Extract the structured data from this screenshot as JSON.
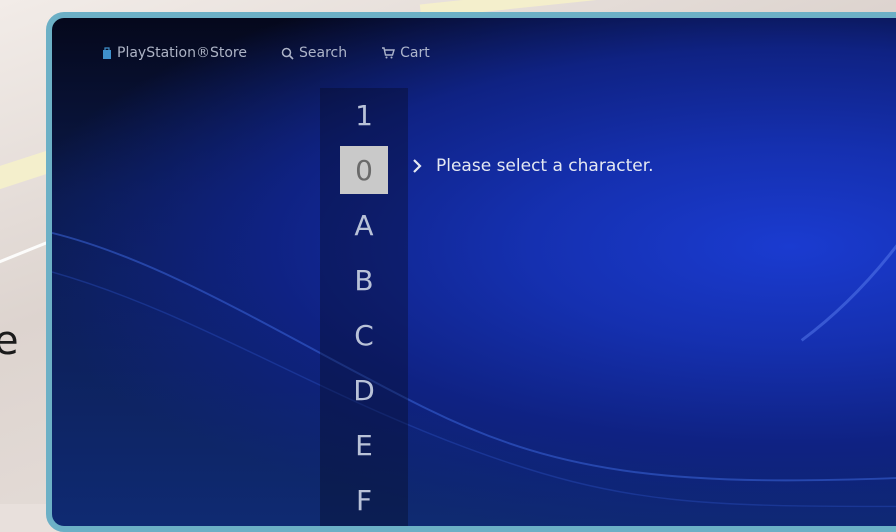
{
  "topbar": {
    "store_label": "PlayStation®Store",
    "search_label": "Search",
    "cart_label": "Cart"
  },
  "character_list": {
    "items": [
      "1",
      "0",
      "A",
      "B",
      "C",
      "D",
      "E",
      "F"
    ],
    "selected": "0"
  },
  "prompt": {
    "text": "Please select a character."
  },
  "backdrop": {
    "partial_letter": "e"
  },
  "colors": {
    "window_border": "#6cb0c6",
    "selection_bg": "#c9c9c9",
    "accent_blue": "#1a3bd0"
  },
  "icons": {
    "store": "playstation-store-bag-icon",
    "search": "magnifier-search-icon",
    "cart": "shopping-cart-icon",
    "prompt": "chevron-right-icon"
  }
}
